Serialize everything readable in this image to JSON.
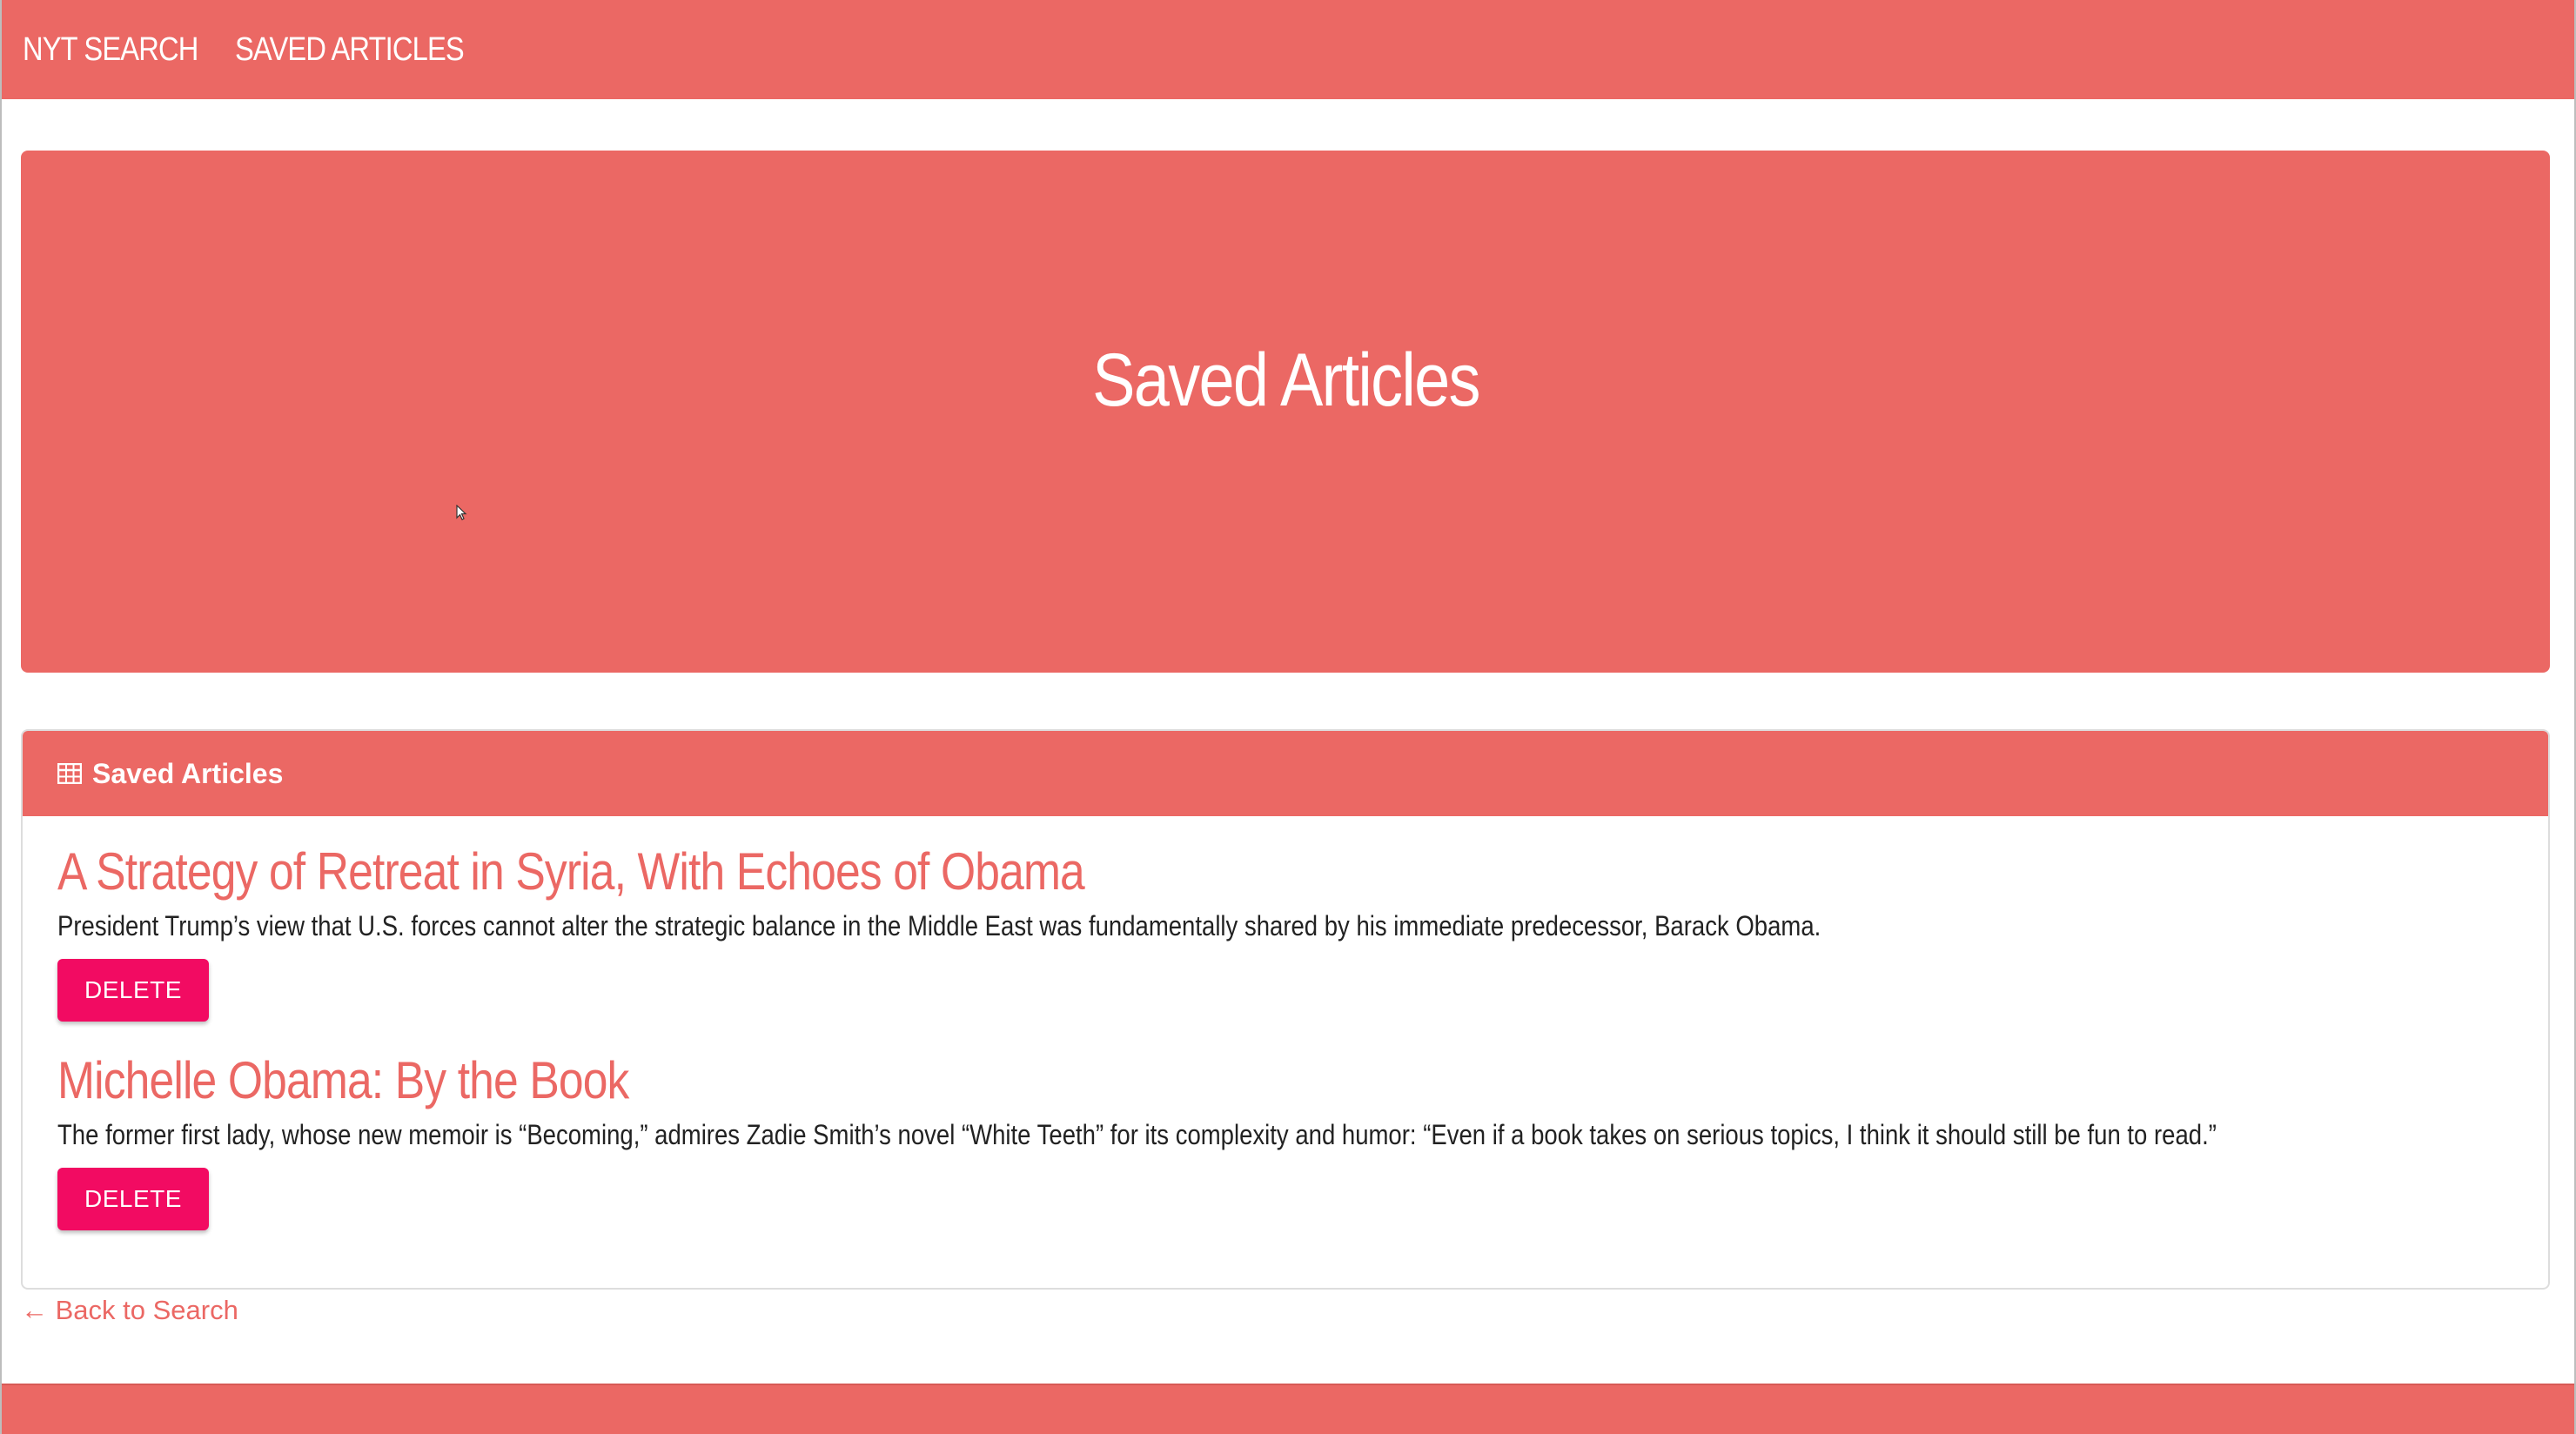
{
  "nav": {
    "brand": "NYT SEARCH",
    "saved_link": "SAVED ARTICLES"
  },
  "jumbotron": {
    "title": "Saved Articles"
  },
  "panel": {
    "heading": "Saved Articles",
    "heading_icon": "table-icon",
    "articles": [
      {
        "title": "A Strategy of Retreat in Syria, With Echoes of Obama",
        "summary": "President Trump’s view that U.S. forces cannot alter the strategic balance in the Middle East was fundamentally shared by his immediate predecessor, Barack Obama.",
        "delete_label": "DELETE"
      },
      {
        "title": "Michelle Obama: By the Book",
        "summary": "The former first lady, whose new memoir is “Becoming,” admires Zadie Smith’s novel “White Teeth” for its complexity and humor: “Even if a book takes on serious topics, I think it should still be fun to read.”",
        "delete_label": "DELETE"
      }
    ]
  },
  "back_link": "← Back to Search",
  "colors": {
    "accent": "#eb6864",
    "delete_button": "#f20b62"
  }
}
